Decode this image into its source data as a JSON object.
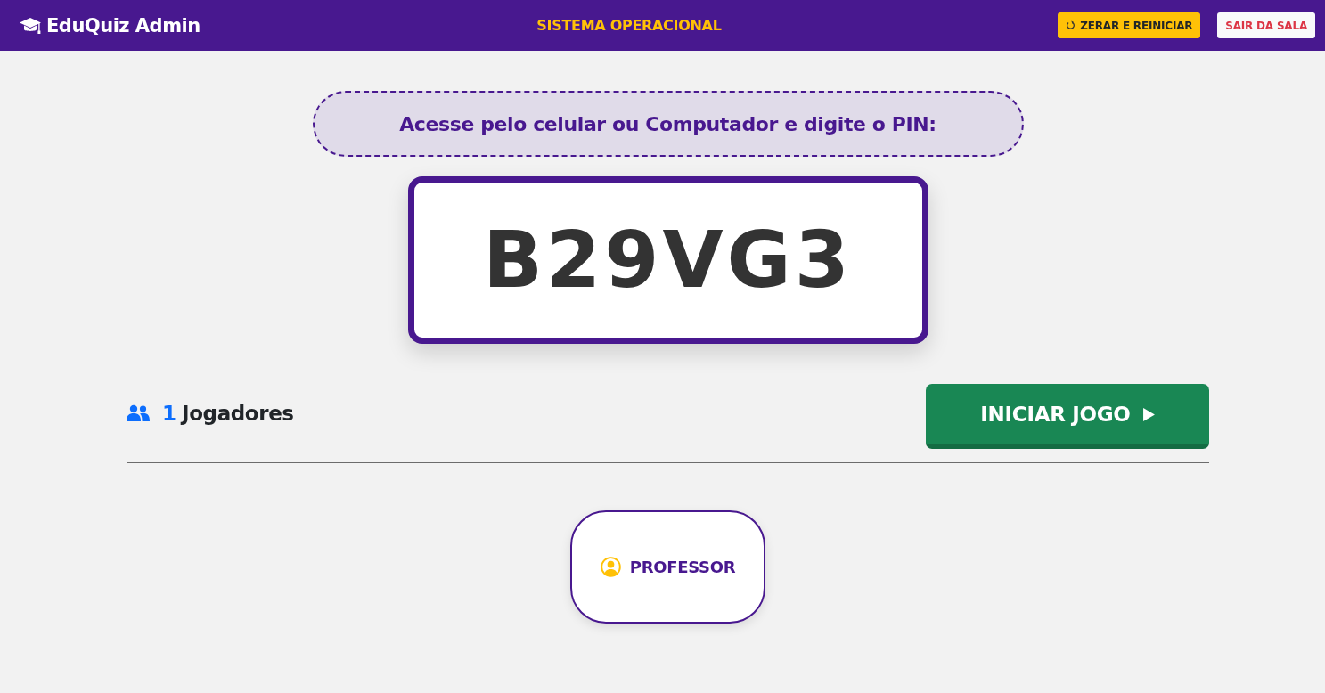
{
  "header": {
    "brand": "EduQuiz Admin",
    "status": "SISTEMA OPERACIONAL",
    "buttons": [
      {
        "label": "ZERAR E REINICIAR",
        "kind": "reset"
      },
      {
        "label": "SAIR DA SALA",
        "kind": "exit"
      }
    ]
  },
  "instruction": "Acesse pelo celular ou Computador e digite o PIN:",
  "pin": "B29VG3",
  "players_summary": {
    "count": "1",
    "label": "Jogadores"
  },
  "start_button": {
    "label": "INICIAR JOGO"
  },
  "players": [
    {
      "name": "PROFESSOR"
    }
  ]
}
